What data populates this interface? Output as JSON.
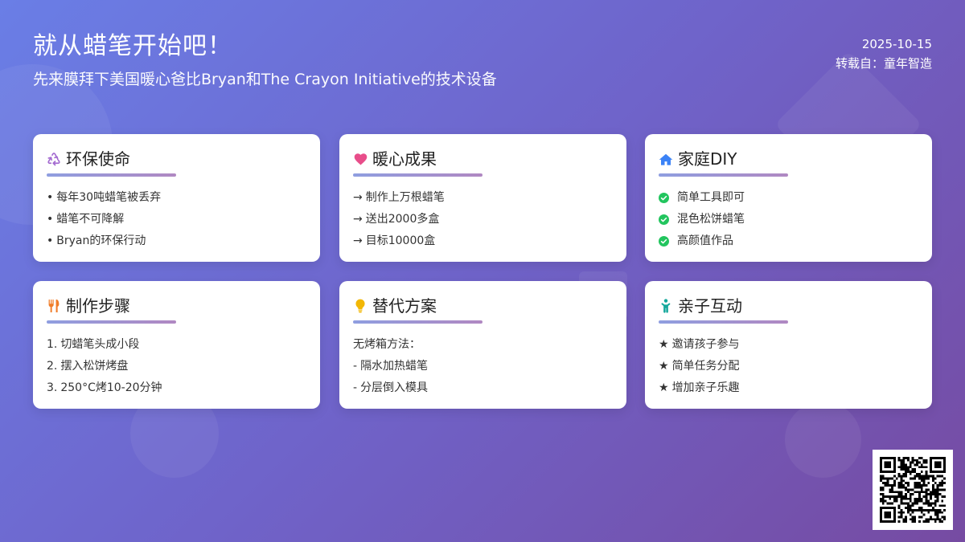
{
  "header": {
    "title": "就从蜡笔开始吧！",
    "subtitle": "先来膜拜下美国暖心爸比Bryan和The Crayon Initiative的技术设备",
    "date": "2025-10-15",
    "source": "转载自：童年智造"
  },
  "colors": {
    "background_start": "#6a7ee6",
    "background_end": "#764ba2",
    "card_line_start": "#8f9ee0",
    "card_line_end": "#b088c2",
    "icon_recycle": "#a36ad0",
    "icon_heart": "#e84d8a",
    "icon_home": "#3b82f6",
    "icon_utensils": "#f07c28",
    "icon_bulb": "#f2b705",
    "icon_child": "#14a79b",
    "check_green": "#22c55e"
  },
  "cards": [
    {
      "title": "环保使命",
      "icon": "recycle-icon",
      "items": [
        {
          "prefix": "•",
          "text": "每年30吨蜡笔被丢弃"
        },
        {
          "prefix": "•",
          "text": "蜡笔不可降解"
        },
        {
          "prefix": "•",
          "text": "Bryan的环保行动"
        }
      ]
    },
    {
      "title": "暖心成果",
      "icon": "heart-icon",
      "items": [
        {
          "prefix": "→",
          "text": "制作上万根蜡笔"
        },
        {
          "prefix": "→",
          "text": "送出2000多盒"
        },
        {
          "prefix": "→",
          "text": "目标10000盒"
        }
      ]
    },
    {
      "title": "家庭DIY",
      "icon": "home-icon",
      "items": [
        {
          "prefix": "",
          "text": "简单工具即可"
        },
        {
          "prefix": "",
          "text": "混色松饼蜡笔"
        },
        {
          "prefix": "",
          "text": "高颜值作品"
        }
      ]
    },
    {
      "title": "制作步骤",
      "icon": "utensils-icon",
      "items": [
        {
          "prefix": "1.",
          "text": "切蜡笔头成小段"
        },
        {
          "prefix": "2.",
          "text": "摆入松饼烤盘"
        },
        {
          "prefix": "3.",
          "text": "250°C烤10-20分钟"
        }
      ]
    },
    {
      "title": "替代方案",
      "icon": "lightbulb-icon",
      "items": [
        {
          "prefix": "",
          "text": "无烤箱方法："
        },
        {
          "prefix": "-",
          "text": "隔水加热蜡笔"
        },
        {
          "prefix": "-",
          "text": "分层倒入模具"
        }
      ]
    },
    {
      "title": "亲子互动",
      "icon": "child-icon",
      "items": [
        {
          "prefix": "★",
          "text": "邀请孩子参与"
        },
        {
          "prefix": "★",
          "text": "简单任务分配"
        },
        {
          "prefix": "★",
          "text": "增加亲子乐趣"
        }
      ]
    }
  ],
  "qr_code": {
    "icon": "qr-code-icon"
  }
}
